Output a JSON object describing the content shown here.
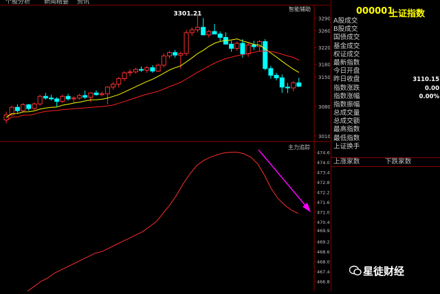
{
  "tabs": [
    "个股分析",
    "新闻精要",
    "资讯"
  ],
  "price_panel": {
    "label": "智能辅助",
    "peak_label": "3301.21",
    "ticks": [
      "3290",
      "3260",
      "3220",
      "3180",
      "3150",
      "3080",
      "3010"
    ]
  },
  "indicator_panel": {
    "label": "主力追踪",
    "ticks": [
      "474.6",
      "474.0",
      "473.4",
      "472.8",
      "472.2",
      "471.6",
      "471.0",
      "470.4",
      "469.9",
      "469.2",
      "468.6",
      "468.0",
      "467.4",
      "466.8"
    ]
  },
  "quote": {
    "code": "000001",
    "name": "上证指数",
    "rows": [
      {
        "label": "A股成交",
        "value": ""
      },
      {
        "label": "B股成交",
        "value": ""
      },
      {
        "label": "国债成交",
        "value": ""
      },
      {
        "label": "基金成交",
        "value": ""
      },
      {
        "label": "权证成交",
        "value": ""
      },
      {
        "label": "最新指数",
        "value": ""
      },
      {
        "label": "今日开盘",
        "value": ""
      },
      {
        "label": "昨日收盘",
        "value": "3110.15"
      },
      {
        "label": "指数涨跌",
        "value": "0.00"
      },
      {
        "label": "指数涨幅",
        "value": "0.00%"
      },
      {
        "label": "指数振幅",
        "value": ""
      },
      {
        "label": "总成交量",
        "value": ""
      },
      {
        "label": "总成交额",
        "value": ""
      },
      {
        "label": "最高指数",
        "value": ""
      },
      {
        "label": "最低指数",
        "value": ""
      },
      {
        "label": "上证换手",
        "value": ""
      }
    ],
    "up_label": "上涨家数",
    "down_label": "下跌家数"
  },
  "watermark": "星徒财经",
  "colors": {
    "up": "#ff3232",
    "down": "#00ffff",
    "ma1": "#ffff00",
    "ma2": "#ff2020",
    "indicator": "#ff3030",
    "arrow": "#ff00ff",
    "border": "#8b0000"
  },
  "chart_data": [
    {
      "type": "candlestick",
      "y_range": [
        3000,
        3310
      ],
      "annotation": "3301.21",
      "candles": [
        {
          "o": 3048,
          "h": 3068,
          "l": 3040,
          "c": 3060
        },
        {
          "o": 3060,
          "h": 3082,
          "l": 3058,
          "c": 3078
        },
        {
          "o": 3078,
          "h": 3085,
          "l": 3065,
          "c": 3070
        },
        {
          "o": 3070,
          "h": 3088,
          "l": 3066,
          "c": 3084
        },
        {
          "o": 3084,
          "h": 3086,
          "l": 3070,
          "c": 3075
        },
        {
          "o": 3075,
          "h": 3090,
          "l": 3072,
          "c": 3086
        },
        {
          "o": 3086,
          "h": 3108,
          "l": 3082,
          "c": 3104
        },
        {
          "o": 3104,
          "h": 3112,
          "l": 3096,
          "c": 3100
        },
        {
          "o": 3100,
          "h": 3108,
          "l": 3094,
          "c": 3098
        },
        {
          "o": 3098,
          "h": 3102,
          "l": 3080,
          "c": 3092
        },
        {
          "o": 3092,
          "h": 3108,
          "l": 3088,
          "c": 3104
        },
        {
          "o": 3104,
          "h": 3110,
          "l": 3094,
          "c": 3098
        },
        {
          "o": 3098,
          "h": 3104,
          "l": 3090,
          "c": 3100
        },
        {
          "o": 3100,
          "h": 3110,
          "l": 3096,
          "c": 3106
        },
        {
          "o": 3106,
          "h": 3118,
          "l": 3098,
          "c": 3102
        },
        {
          "o": 3102,
          "h": 3114,
          "l": 3090,
          "c": 3112
        },
        {
          "o": 3112,
          "h": 3118,
          "l": 3106,
          "c": 3108
        },
        {
          "o": 3108,
          "h": 3115,
          "l": 3104,
          "c": 3110
        },
        {
          "o": 3110,
          "h": 3128,
          "l": 3085,
          "c": 3126
        },
        {
          "o": 3126,
          "h": 3138,
          "l": 3120,
          "c": 3133
        },
        {
          "o": 3133,
          "h": 3150,
          "l": 3125,
          "c": 3146
        },
        {
          "o": 3146,
          "h": 3164,
          "l": 3140,
          "c": 3160
        },
        {
          "o": 3160,
          "h": 3168,
          "l": 3152,
          "c": 3162
        },
        {
          "o": 3162,
          "h": 3172,
          "l": 3158,
          "c": 3168
        },
        {
          "o": 3168,
          "h": 3175,
          "l": 3162,
          "c": 3166
        },
        {
          "o": 3166,
          "h": 3176,
          "l": 3160,
          "c": 3172
        },
        {
          "o": 3172,
          "h": 3178,
          "l": 3160,
          "c": 3164
        },
        {
          "o": 3164,
          "h": 3182,
          "l": 3162,
          "c": 3178
        },
        {
          "o": 3178,
          "h": 3206,
          "l": 3172,
          "c": 3200
        },
        {
          "o": 3200,
          "h": 3212,
          "l": 3194,
          "c": 3208
        },
        {
          "o": 3208,
          "h": 3214,
          "l": 3196,
          "c": 3202
        },
        {
          "o": 3202,
          "h": 3210,
          "l": 3170,
          "c": 3206
        },
        {
          "o": 3206,
          "h": 3262,
          "l": 3200,
          "c": 3255
        },
        {
          "o": 3255,
          "h": 3268,
          "l": 3248,
          "c": 3262
        },
        {
          "o": 3262,
          "h": 3301,
          "l": 3256,
          "c": 3268
        },
        {
          "o": 3268,
          "h": 3290,
          "l": 3255,
          "c": 3250
        },
        {
          "o": 3250,
          "h": 3262,
          "l": 3244,
          "c": 3258
        },
        {
          "o": 3258,
          "h": 3276,
          "l": 3252,
          "c": 3252
        },
        {
          "o": 3252,
          "h": 3258,
          "l": 3236,
          "c": 3244
        },
        {
          "o": 3244,
          "h": 3256,
          "l": 3230,
          "c": 3228
        },
        {
          "o": 3228,
          "h": 3236,
          "l": 3210,
          "c": 3218
        },
        {
          "o": 3218,
          "h": 3234,
          "l": 3212,
          "c": 3230
        },
        {
          "o": 3230,
          "h": 3240,
          "l": 3196,
          "c": 3205
        },
        {
          "o": 3205,
          "h": 3232,
          "l": 3198,
          "c": 3226
        },
        {
          "o": 3226,
          "h": 3236,
          "l": 3214,
          "c": 3222
        },
        {
          "o": 3222,
          "h": 3238,
          "l": 3210,
          "c": 3234
        },
        {
          "o": 3234,
          "h": 3240,
          "l": 3166,
          "c": 3170
        },
        {
          "o": 3170,
          "h": 3176,
          "l": 3146,
          "c": 3154
        },
        {
          "o": 3154,
          "h": 3160,
          "l": 3142,
          "c": 3148
        },
        {
          "o": 3148,
          "h": 3156,
          "l": 3112,
          "c": 3126
        },
        {
          "o": 3126,
          "h": 3136,
          "l": 3112,
          "c": 3124
        },
        {
          "o": 3124,
          "h": 3140,
          "l": 3116,
          "c": 3136
        },
        {
          "o": 3136,
          "h": 3148,
          "l": 3126,
          "c": 3128
        }
      ]
    },
    {
      "type": "line",
      "name": "主力追踪",
      "y_range": [
        466.2,
        475.0
      ],
      "values": [
        466.2,
        466.5,
        466.8,
        467.0,
        467.3,
        467.5,
        467.7,
        467.9,
        468.1,
        468.3,
        468.5,
        468.6,
        468.8,
        469.0,
        469.2,
        469.4,
        469.6,
        469.8,
        470.1,
        470.4,
        470.9,
        471.4,
        472.0,
        472.7,
        473.3,
        473.8,
        474.1,
        474.3,
        474.45,
        474.55,
        474.6,
        474.6,
        474.5,
        474.3,
        473.9,
        473.2,
        472.4,
        471.8,
        471.4,
        471.1,
        470.9
      ]
    }
  ]
}
